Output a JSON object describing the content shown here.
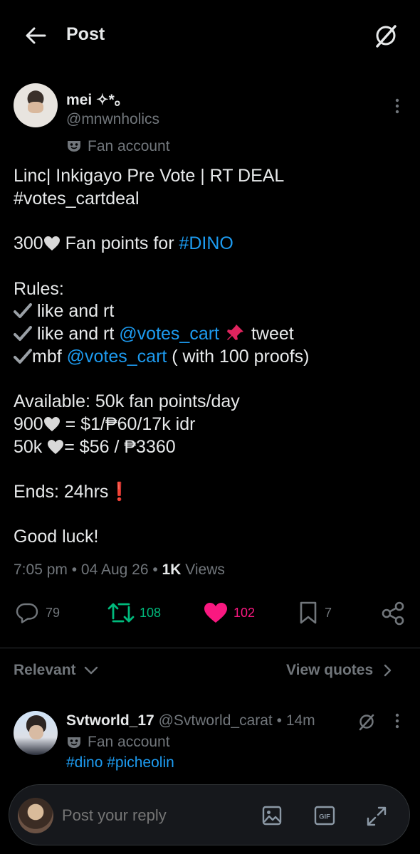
{
  "header": {
    "title": "Post"
  },
  "author": {
    "name": "mei ✧*。",
    "handle": "@mnwnholics",
    "label": "Fan account"
  },
  "tweet": {
    "line1": "Linc| Inkigayo Pre Vote | RT DEAL",
    "hashtag1": "#votes_cartdeal",
    "fan_points_a": "300",
    "fan_points_b": " Fan points for ",
    "hashtag_dino": "#DINO",
    "rules": "Rules:",
    "rule1": " like and rt",
    "rule2a": " like and rt ",
    "rule2_mention": "@votes_cart",
    "rule2b": " tweet",
    "rule3a": "mbf ",
    "rule3_mention": "@votes_cart",
    "rule3b": " ( with 100 proofs)",
    "available": "Available: 50k fan points/day",
    "price1a": "900",
    "price1b": " = $1/₱60/17k idr",
    "price2a": "50k ",
    "price2b": "= $56 / ₱3360",
    "ends": "Ends: 24hrs",
    "ends_emoji": "❗",
    "goodluck": "Good luck!"
  },
  "meta": {
    "time": "7:05 pm",
    "date": "04 Aug 26",
    "views_count": "1K",
    "views_label": "Views"
  },
  "actions": {
    "replies": "79",
    "retweets": "108",
    "likes": "102",
    "bookmarks": "7"
  },
  "sort": {
    "label": "Relevant",
    "view_quotes": "View quotes"
  },
  "reply": {
    "name": "Svtworld_17",
    "handle": "@Svtworld_carat",
    "time": "14m",
    "label": "Fan account",
    "hashtags": "#dino #picheolin"
  },
  "composer": {
    "placeholder": "Post your reply"
  },
  "colors": {
    "accent": "#1d9bf0",
    "retweet": "#00ba7c",
    "like": "#f91880",
    "muted": "#71767b"
  }
}
